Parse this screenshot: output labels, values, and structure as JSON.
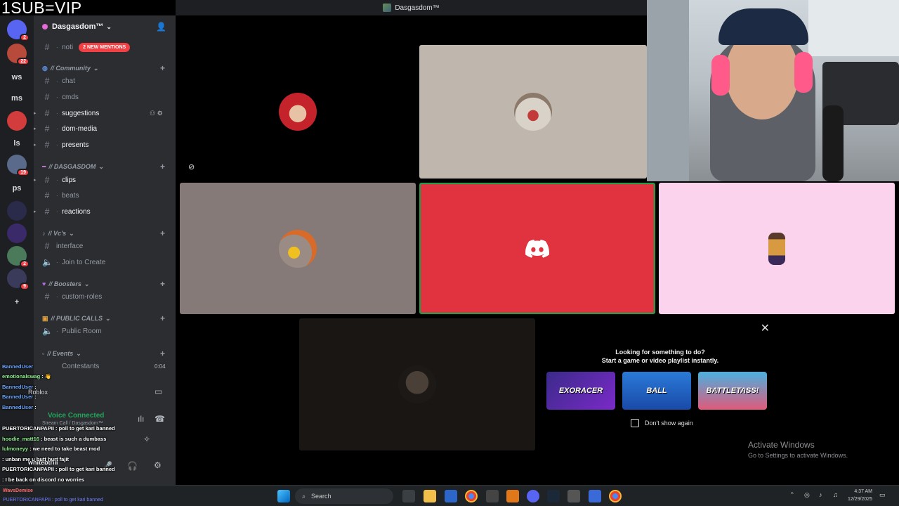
{
  "overlay": {
    "vip_text": "1SUB=VIP"
  },
  "window": {
    "title": "Dasgasdom™"
  },
  "rail": {
    "items": [
      {
        "label": "",
        "badge": "2",
        "color": "#5865f2",
        "icon": "discord-icon"
      },
      {
        "label": "",
        "badge": "22",
        "color": "#b84a3b",
        "icon": "server-icon"
      },
      {
        "label": "ws",
        "badge": "",
        "color": "#1e1f22",
        "icon": ""
      },
      {
        "label": "ms",
        "badge": "",
        "color": "#1e1f22",
        "icon": ""
      },
      {
        "label": "",
        "badge": "",
        "color": "#d23c3c",
        "icon": "server-icon"
      },
      {
        "label": "ls",
        "badge": "",
        "color": "#1e1f22",
        "icon": ""
      },
      {
        "label": "",
        "badge": "19",
        "color": "#5a6a8a",
        "icon": "server-icon"
      },
      {
        "label": "ps",
        "badge": "",
        "color": "#1e1f22",
        "icon": ""
      },
      {
        "label": "",
        "badge": "",
        "color": "#2a2a4a",
        "icon": "server-icon"
      },
      {
        "label": "",
        "badge": "",
        "color": "#3a2a6a",
        "icon": "server-icon"
      },
      {
        "label": "",
        "badge": "2",
        "color": "#4a7a5a",
        "icon": "server-icon"
      },
      {
        "label": "",
        "badge": "9",
        "color": "#3a3a5a",
        "icon": "server-icon"
      },
      {
        "label": "+",
        "badge": "",
        "color": "#1e1f22",
        "icon": "add-server-icon"
      },
      {
        "label": "",
        "badge": "",
        "color": "#1e1f22",
        "icon": "discover-icon"
      }
    ]
  },
  "sidebar": {
    "server_name": "Dasgasdom™",
    "channels": {
      "noti": "noti",
      "mentions": "2 NEW MENTIONS",
      "cat_community": "// Community",
      "chat": "chat",
      "cmds": "cmds",
      "suggestions": "suggestions",
      "dom_media": "dom-media",
      "presents": "presents",
      "cat_dasgasdom": "// DASGASDOM",
      "clips": "clips",
      "beats": "beats",
      "reactions": "reactions",
      "cat_vcs": "// Vc's",
      "interface": "interface",
      "join_to_create": "Join to Create",
      "cat_boosters": "// Boosters",
      "custom_roles": "custom-roles",
      "cat_public_calls": "// PUBLIC CALLS",
      "public_room": "Public Room",
      "cat_events": "// Events",
      "contestants": "Contestants"
    },
    "timer": "0:04",
    "voice_connected": "Voice Connected",
    "voice_sub": "Stream Call / Dasgasdom™",
    "activity": "Roblox",
    "username": "whitebtrill"
  },
  "chat_overlay": [
    {
      "user": "BannedUser",
      "msg": "",
      "color": "u1"
    },
    {
      "user": "emotionalswag",
      "msg": ": 👋",
      "color": "u2"
    },
    {
      "user": "BannedUser",
      "msg": ":",
      "color": "u1"
    },
    {
      "user": "BannedUser",
      "msg": ":",
      "color": "u1"
    },
    {
      "user": "BannedUser",
      "msg": ":",
      "color": "u1"
    },
    {
      "user": "PUERTORICANPAPII",
      "msg": ": poll to get kari banned",
      "color": ""
    },
    {
      "user": "hoodie_matt16",
      "msg": ": beast is such a dumbass",
      "color": "u2"
    },
    {
      "user": "lulmoneyy",
      "msg": ": we need to take beast mod",
      "color": "u2"
    },
    {
      "user": "",
      "msg": ": unban me u butt hurt fajit",
      "color": "u3"
    },
    {
      "user": "PUERTORICANPAPII",
      "msg": ": poll to get kari banned",
      "color": ""
    },
    {
      "user": "",
      "msg": ": I be back on discord no worries",
      "color": "u3"
    }
  ],
  "popup": {
    "line1": "Looking for something to do?",
    "line2": "Start a game or video playlist instantly.",
    "games": [
      "EXORACER",
      "BALL",
      "BATTLETASS!"
    ],
    "dont_show": "Don't show again"
  },
  "activate": {
    "line1": "Activate Windows",
    "line2": "Go to Settings to activate Windows."
  },
  "taskbar": {
    "streamer": "WavsDemise",
    "ticker": "PUERTORICANPAPII : poll to get kari banned",
    "search": "Search",
    "time": "4:37 AM",
    "date": "12/29/2025"
  },
  "colors": {
    "accent": "#5865f2",
    "discord_red_tile": "#e0333f",
    "pink_tile": "#fbd3ec",
    "grey_tile": "#857a77",
    "beige_tile": "#bfb7ae"
  }
}
